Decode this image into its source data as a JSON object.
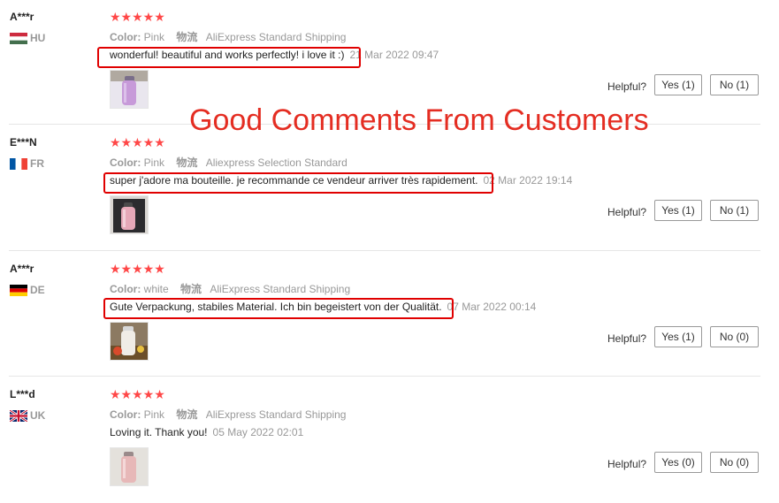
{
  "banner": "Good Comments From Customers",
  "labels": {
    "color_label": "Color:",
    "shipping_label": "物流",
    "helpful_label": "Helpful?"
  },
  "accent_color": "#ff4747",
  "highlight_color": "#e00000",
  "reviews": [
    {
      "user": "A***r",
      "country": "HU",
      "flag_icon": "hungary-flag-icon",
      "stars": "★★★★★",
      "color": "Pink",
      "shipping": "AliExpress Standard Shipping",
      "comment": "wonderful! beautiful and works perfectly! i love it :)",
      "date": "21 Mar 2022 09:47",
      "yes": "Yes (1)",
      "no": "No (1)"
    },
    {
      "user": "E***N",
      "country": "FR",
      "flag_icon": "france-flag-icon",
      "stars": "★★★★★",
      "color": "Pink",
      "shipping": "Aliexpress Selection Standard",
      "comment": "super j'adore ma bouteille. je recommande ce vendeur arriver très rapidement.",
      "date": "02 Mar 2022 19:14",
      "yes": "Yes (1)",
      "no": "No (1)"
    },
    {
      "user": "A***r",
      "country": "DE",
      "flag_icon": "germany-flag-icon",
      "stars": "★★★★★",
      "color": "white",
      "shipping": "AliExpress Standard Shipping",
      "comment": "Gute Verpackung, stabiles Material. Ich bin begeistert von der Qualität.",
      "date": "07 Mar 2022 00:14",
      "yes": "Yes (1)",
      "no": "No (0)"
    },
    {
      "user": "L***d",
      "country": "UK",
      "flag_icon": "uk-flag-icon",
      "stars": "★★★★★",
      "color": "Pink",
      "shipping": "AliExpress Standard Shipping",
      "comment": "Loving it. Thank you!",
      "date": "05 May 2022 02:01",
      "yes": "Yes (0)",
      "no": "No (0)"
    }
  ]
}
